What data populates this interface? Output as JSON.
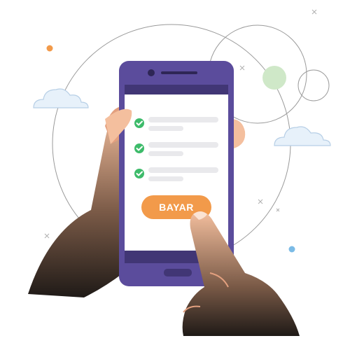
{
  "screen": {
    "checklist_items": [
      {
        "checked": true
      },
      {
        "checked": true
      },
      {
        "checked": true
      }
    ],
    "pay_button": {
      "label": "BAYAR"
    }
  },
  "colors": {
    "phone_body": "#5b4c9c",
    "phone_bezel": "#413675",
    "screen_bg": "#ffffff",
    "check_green": "#3dbb6a",
    "placeholder_line": "#e9e9ec",
    "button_orange": "#f29a4a",
    "skin": "#f4bf9e",
    "skin_shadow": "#e3a07f",
    "cloud": "#e7f1fa",
    "cloud_outline": "#b7cfe6",
    "orbit_line": "#9a9a9a",
    "accent_green_circle": "#cfe8c8",
    "accent_orange_dot": "#f29a4a",
    "accent_blue_dot": "#7bbbe6"
  },
  "icons": [
    "check-icon",
    "cloud-icon",
    "camera-icon",
    "speaker-icon",
    "home-button-icon"
  ]
}
